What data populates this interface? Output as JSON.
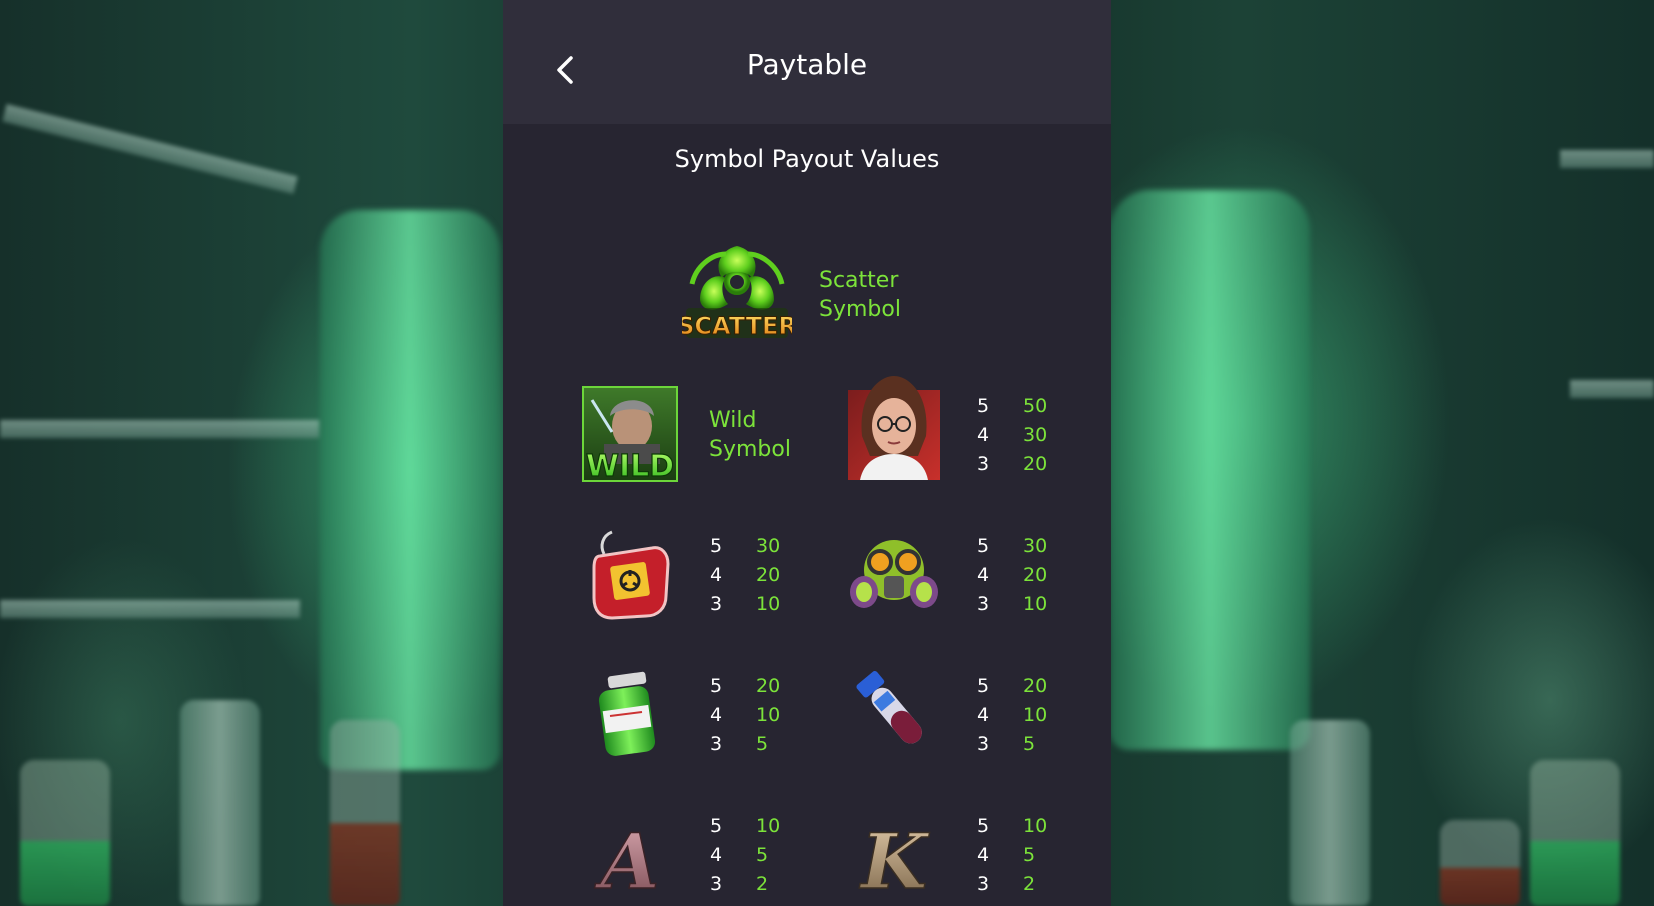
{
  "header": {
    "title": "Paytable",
    "back_icon": "chevron-left-icon"
  },
  "section": {
    "title": "Symbol Payout Values"
  },
  "colors": {
    "panel": "#272531",
    "header": "#302e3b",
    "accent_green": "#7ce33a",
    "text": "#ffffff"
  },
  "scatter": {
    "icon": "biohazard-scatter-icon",
    "icon_text": "SCATTER",
    "label_line1": "Scatter",
    "label_line2": "Symbol"
  },
  "wild": {
    "icon": "wild-scientist-icon",
    "icon_text": "WILD",
    "label_line1": "Wild",
    "label_line2": "Symbol"
  },
  "symbols": [
    {
      "icon": "female-scientist-icon",
      "payouts": [
        {
          "count": "5",
          "value": "50"
        },
        {
          "count": "4",
          "value": "30"
        },
        {
          "count": "3",
          "value": "20"
        }
      ]
    },
    {
      "icon": "blood-bag-icon",
      "payouts": [
        {
          "count": "5",
          "value": "30"
        },
        {
          "count": "4",
          "value": "20"
        },
        {
          "count": "3",
          "value": "10"
        }
      ]
    },
    {
      "icon": "gas-mask-icon",
      "payouts": [
        {
          "count": "5",
          "value": "30"
        },
        {
          "count": "4",
          "value": "20"
        },
        {
          "count": "3",
          "value": "10"
        }
      ]
    },
    {
      "icon": "green-vial-icon",
      "payouts": [
        {
          "count": "5",
          "value": "20"
        },
        {
          "count": "4",
          "value": "10"
        },
        {
          "count": "3",
          "value": "5"
        }
      ]
    },
    {
      "icon": "test-tube-icon",
      "payouts": [
        {
          "count": "5",
          "value": "20"
        },
        {
          "count": "4",
          "value": "10"
        },
        {
          "count": "3",
          "value": "5"
        }
      ]
    },
    {
      "icon": "letter-a-icon",
      "icon_text": "A",
      "payouts": [
        {
          "count": "5",
          "value": "10"
        },
        {
          "count": "4",
          "value": "5"
        },
        {
          "count": "3",
          "value": "2"
        }
      ]
    },
    {
      "icon": "letter-k-icon",
      "icon_text": "K",
      "payouts": [
        {
          "count": "5",
          "value": "10"
        },
        {
          "count": "4",
          "value": "5"
        },
        {
          "count": "3",
          "value": "2"
        }
      ]
    }
  ]
}
